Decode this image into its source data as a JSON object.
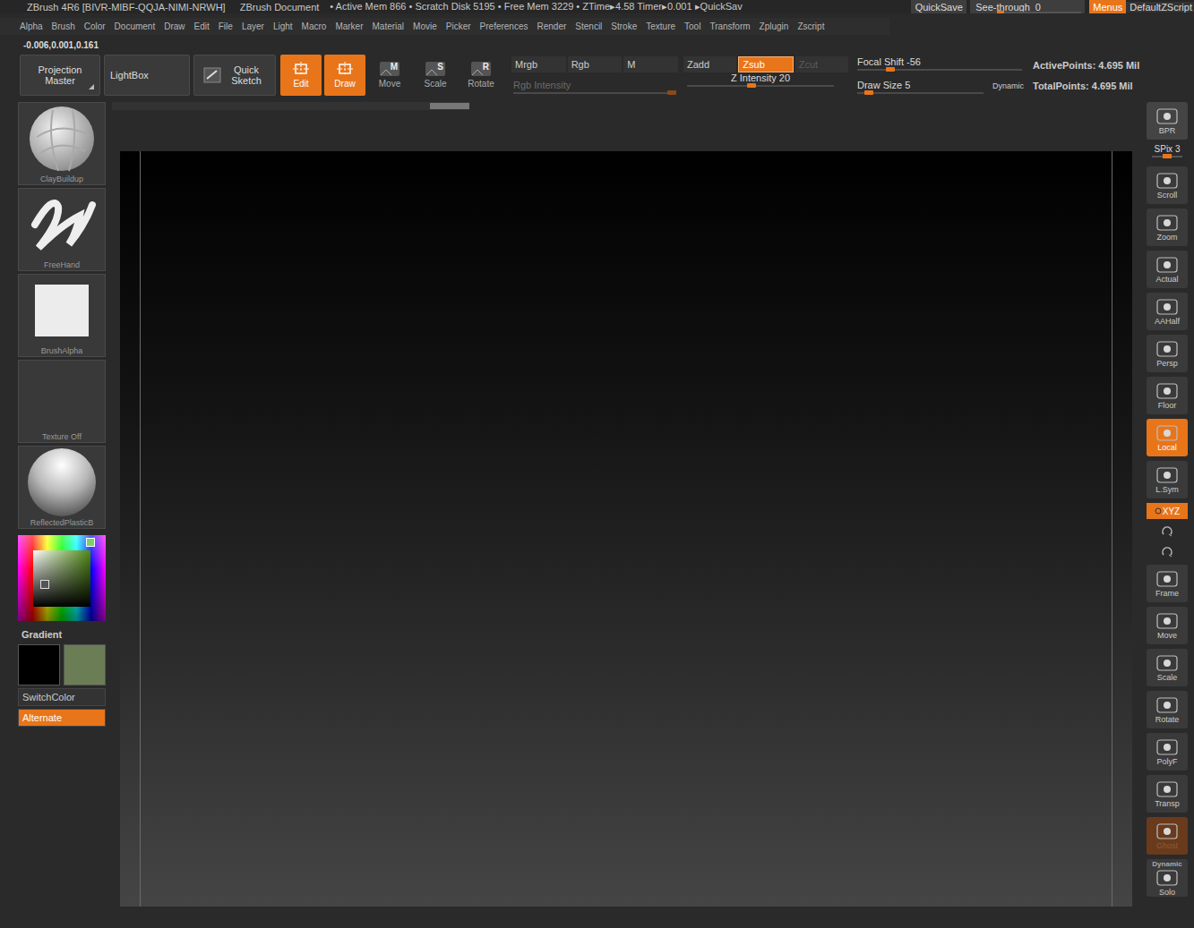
{
  "title_bar": {
    "app": "ZBrush 4R6 [BIVR-MIBF-QQJA-NIMI-NRWH]",
    "document": "ZBrush Document",
    "stats": "• Active Mem 866 • Scratch Disk 5195 • Free Mem 3229 • ZTime▸4.58 Timer▸0.001 ▸QuickSav",
    "quicksave": "QuickSave",
    "see_through": {
      "label": "See-through",
      "value": "0",
      "level": 0
    },
    "menus": {
      "label": "Menus",
      "on": true
    },
    "script": "DefaultZScript"
  },
  "menu": [
    "Alpha",
    "Brush",
    "Color",
    "Document",
    "Draw",
    "Edit",
    "File",
    "Layer",
    "Light",
    "Macro",
    "Marker",
    "Material",
    "Movie",
    "Picker",
    "Preferences",
    "Render",
    "Stencil",
    "Stroke",
    "Texture",
    "Tool",
    "Transform",
    "Zplugin",
    "Zscript"
  ],
  "coordinates": "-0.006,0.001,0.161",
  "toolbar": {
    "projection_master": "Projection Master",
    "lightbox": "LightBox",
    "quick_sketch": "Quick Sketch",
    "modes": [
      {
        "label": "Edit",
        "kind": "draw-mode",
        "selected": true
      },
      {
        "label": "Draw",
        "kind": "draw-mode",
        "selected": true
      },
      {
        "label": "Move",
        "kind": "transform",
        "key": "M",
        "selected": false
      },
      {
        "label": "Scale",
        "kind": "transform",
        "key": "S",
        "selected": false
      },
      {
        "label": "Rotate",
        "kind": "transform",
        "key": "R",
        "selected": false
      }
    ],
    "color_modes": [
      {
        "label": "Mrgb",
        "selected": false
      },
      {
        "label": "Rgb",
        "selected": false
      },
      {
        "label": "M",
        "selected": false
      }
    ],
    "rgb_intensity": {
      "label": "Rgb Intensity",
      "level": 0.97,
      "disabled": true
    },
    "z_modes": [
      {
        "label": "Zadd",
        "selected": false,
        "disabled": false
      },
      {
        "label": "Zsub",
        "selected": true,
        "disabled": false
      },
      {
        "label": "Zcut",
        "selected": false,
        "disabled": true
      }
    ],
    "z_intensity": {
      "label": "Z Intensity",
      "value": "20",
      "level": 0.44
    },
    "focal_shift": {
      "label": "Focal Shift",
      "value": "-56",
      "level": 0.2
    },
    "draw_size": {
      "label": "Draw Size",
      "value": "5",
      "level": 0.09
    },
    "dynamic": "Dynamic",
    "points": [
      {
        "label": "ActivePoints:",
        "value": "4.695 Mil"
      },
      {
        "label": "TotalPoints:",
        "value": "4.695 Mil"
      }
    ]
  },
  "left_shelf": {
    "tiles": [
      {
        "label": "ClayBuildup",
        "kind": "sphere"
      },
      {
        "label": "FreeHand",
        "kind": "stroke"
      },
      {
        "label": "BrushAlpha",
        "kind": "alpha"
      },
      {
        "label": "Texture Off",
        "kind": "empty"
      },
      {
        "label": "ReflectedPlasticB",
        "kind": "material"
      }
    ],
    "gradient": "Gradient",
    "swatches": [
      {
        "color": "#000000"
      },
      {
        "color": "#6b7d55"
      }
    ],
    "switch_color": "SwitchColor",
    "alternate": {
      "label": "Alternate",
      "on": true
    }
  },
  "right_shelf": [
    {
      "kind": "button",
      "label": "BPR",
      "selected": false,
      "disabled": false
    },
    {
      "kind": "slider",
      "label": "SPix",
      "value": "3",
      "level": 0.5
    },
    {
      "kind": "button",
      "label": "Scroll",
      "selected": false,
      "disabled": false
    },
    {
      "kind": "button",
      "label": "Zoom",
      "selected": false,
      "disabled": false
    },
    {
      "kind": "button",
      "label": "Actual",
      "selected": false,
      "disabled": false
    },
    {
      "kind": "button",
      "label": "AAHalf",
      "selected": false,
      "disabled": false
    },
    {
      "kind": "button",
      "label": "Persp",
      "selected": false,
      "disabled": false
    },
    {
      "kind": "button",
      "label": "Floor",
      "selected": false,
      "disabled": false
    },
    {
      "kind": "button",
      "label": "Local",
      "selected": true,
      "disabled": false
    },
    {
      "kind": "button",
      "label": "L.Sym",
      "selected": false,
      "disabled": false
    },
    {
      "kind": "toggle",
      "label": "XYZ",
      "selected": true,
      "disabled": false
    },
    {
      "kind": "mini",
      "selected": false
    },
    {
      "kind": "mini",
      "selected": false
    },
    {
      "kind": "button",
      "label": "Frame",
      "selected": false,
      "disabled": false
    },
    {
      "kind": "button",
      "label": "Move",
      "selected": false,
      "disabled": false
    },
    {
      "kind": "button",
      "label": "Scale",
      "selected": false,
      "disabled": false
    },
    {
      "kind": "button",
      "label": "Rotate",
      "selected": false,
      "disabled": false
    },
    {
      "kind": "button",
      "label": "PolyF",
      "selected": false,
      "disabled": false
    },
    {
      "kind": "button",
      "label": "Transp",
      "selected": false,
      "disabled": false
    },
    {
      "kind": "button",
      "label": "Ghost",
      "selected": true,
      "disabled": true
    },
    {
      "kind": "solo",
      "caption": "Dynamic",
      "label": "Solo",
      "selected": false,
      "disabled": false
    }
  ]
}
